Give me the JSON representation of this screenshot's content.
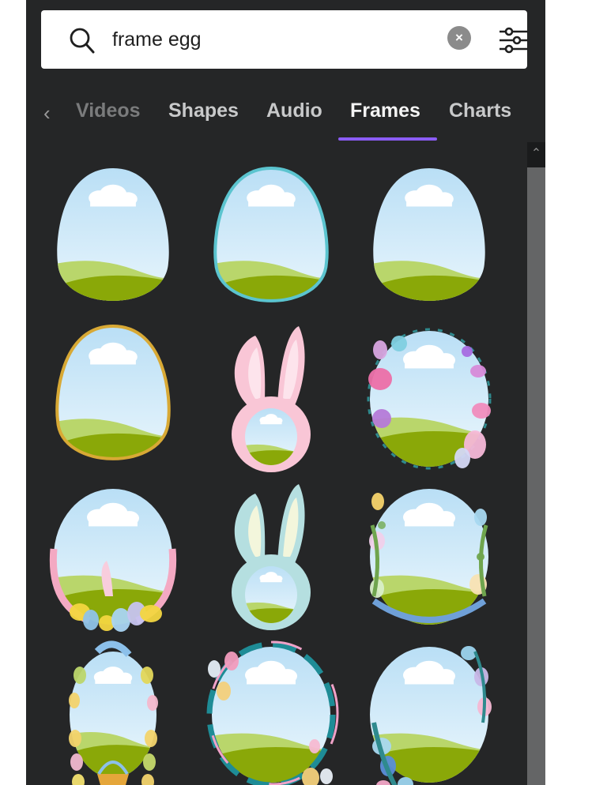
{
  "search": {
    "value": "frame egg",
    "placeholder": "Search",
    "clear_label": "×"
  },
  "tabs": {
    "items": [
      {
        "label": "Videos",
        "state": "faded"
      },
      {
        "label": "Shapes",
        "state": "normal"
      },
      {
        "label": "Audio",
        "state": "normal"
      },
      {
        "label": "Frames",
        "state": "active"
      },
      {
        "label": "Charts",
        "state": "normal"
      }
    ],
    "back_glyph": "‹",
    "active_color": "#8b5cf6"
  },
  "scrollbar": {
    "up_glyph": "⌃"
  },
  "frames": [
    {
      "name": "plain-egg-frame",
      "style": "egg",
      "border": "none"
    },
    {
      "name": "teal-outline-egg-frame",
      "style": "egg",
      "border": "#5bc4cf"
    },
    {
      "name": "plain-egg-frame-2",
      "style": "egg",
      "border": "none"
    },
    {
      "name": "gold-outline-egg-frame",
      "style": "egg",
      "border": "#d8a935"
    },
    {
      "name": "pink-bunny-ears-frame",
      "style": "bunny",
      "border": "#f9c6d6"
    },
    {
      "name": "floral-oval-frame",
      "style": "floral",
      "border": "#e98bbd"
    },
    {
      "name": "chicks-and-eggs-oval-frame",
      "style": "chicks",
      "border": "#f4a9c3"
    },
    {
      "name": "blue-bunny-ears-frame",
      "style": "bunny",
      "border": "#b5dfe0"
    },
    {
      "name": "leafy-eggs-oval-frame",
      "style": "leafy",
      "border": "#6fa0d8"
    },
    {
      "name": "bunny-basket-egg-frame",
      "style": "basket",
      "border": "#f2d36b"
    },
    {
      "name": "teal-wreath-oval-frame",
      "style": "wreath",
      "border": "#1e8c96"
    },
    {
      "name": "blue-floral-oval-frame",
      "style": "bluefloral",
      "border": "#5fa8d8"
    }
  ]
}
